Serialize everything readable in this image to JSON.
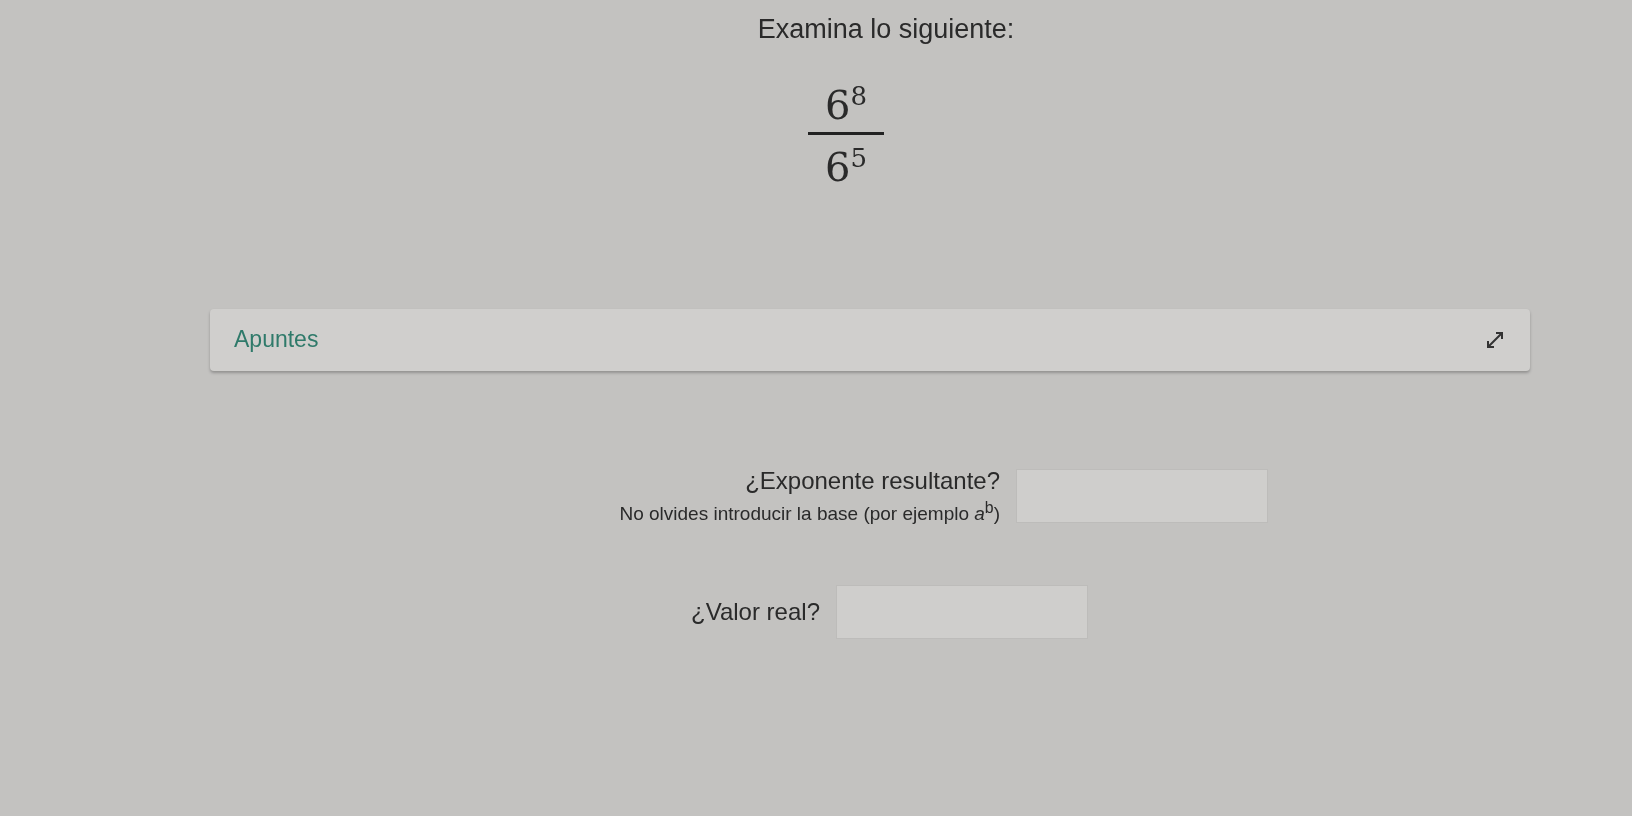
{
  "prompt": "Examina lo siguiente:",
  "expression": {
    "numerator": "6$^{8}$",
    "denominator": "6$^{5}$"
  },
  "notes_panel": {
    "title": "Apuntes"
  },
  "questions": [
    {
      "label": "¿Exponente resultante?",
      "hint": "No olvides introducir la base (por ejemplo *a*$^{b}$)"
    },
    {
      "label": "¿Valor real?"
    }
  ]
}
